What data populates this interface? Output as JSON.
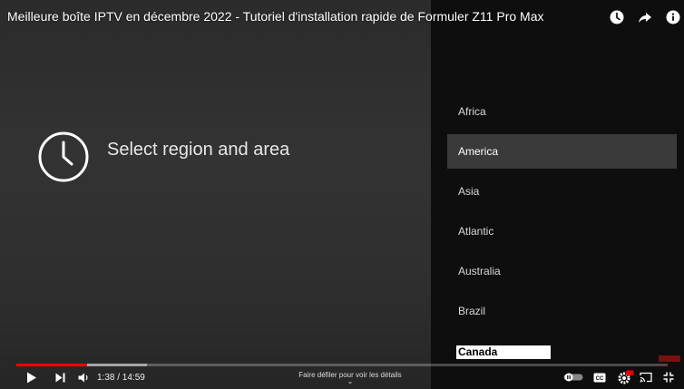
{
  "video": {
    "title": "Meilleure boîte IPTV en décembre 2022 - Tutoriel d'installation rapide de Formuler Z11 Pro Max",
    "heading": "Select region and area",
    "regions": [
      {
        "label": "Africa",
        "selected": false
      },
      {
        "label": "America",
        "selected": true
      },
      {
        "label": "Asia",
        "selected": false
      },
      {
        "label": "Atlantic",
        "selected": false
      },
      {
        "label": "Australia",
        "selected": false
      },
      {
        "label": "Brazil",
        "selected": false
      }
    ],
    "highlighted_region": "Canada"
  },
  "player": {
    "time": "1:38 / 14:59",
    "scroll_hint": "Faire défiler pour voir les détails",
    "progress_fraction": 0.109,
    "buffered_fraction": 0.201,
    "colors": {
      "played": "#ff0000",
      "track": "#666666"
    },
    "top_icons": [
      "watch-later-icon",
      "share-icon",
      "info-icon"
    ],
    "control_icons": [
      "play-icon",
      "next-icon",
      "volume-icon",
      "autoplay-toggle-icon",
      "subtitles-icon",
      "settings-icon",
      "cast-icon",
      "exit-fullscreen-icon"
    ]
  }
}
